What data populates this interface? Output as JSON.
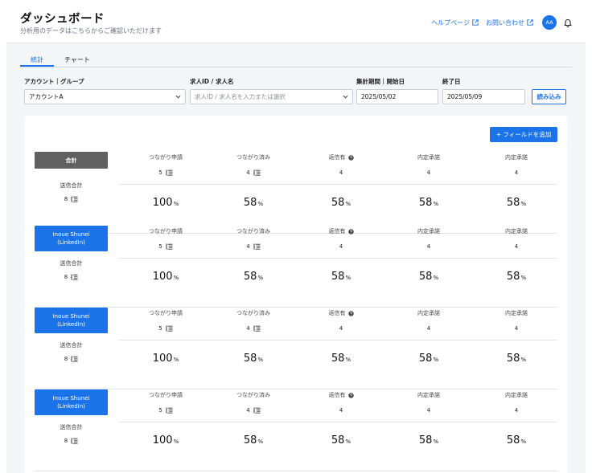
{
  "header": {
    "title": "ダッシュボード",
    "subtitle": "分析用のデータはこちらからご確認いただけます",
    "help_link": "ヘルプページ",
    "contact_link": "お問い合わせ",
    "avatar_initials": "AA"
  },
  "tabs": [
    {
      "label": "統計",
      "active": true
    },
    {
      "label": "チャート",
      "active": false
    }
  ],
  "filters": {
    "account_label": "アカウント｜グループ",
    "account_value": "アカウントA",
    "job_label": "求人ID / 求人名",
    "job_placeholder": "求人ID / 求人名を入力または選択",
    "period_label": "集計期間｜開始日",
    "start_date": "2025/05/02",
    "end_label": "終了日",
    "end_date": "2025/05/09",
    "load_button": "読み込み"
  },
  "add_field_button": "+ フィールドを追加",
  "send_total_label": "送信合計",
  "metric_labels": [
    "つながり申請",
    "つながり済み",
    "返信有",
    "内定承諾",
    "内定承諾"
  ],
  "groups": [
    {
      "name": "合計",
      "kind": "total",
      "send_total": "8",
      "counts": [
        "5",
        "4",
        "4",
        "4",
        "4"
      ],
      "percents": [
        "100",
        "58",
        "58",
        "58",
        "58"
      ]
    },
    {
      "name": "Inoue Shunei\n(LinkedIn)",
      "kind": "user",
      "send_total": "8",
      "counts": [
        "5",
        "4",
        "4",
        "4",
        "4"
      ],
      "percents": [
        "100",
        "58",
        "58",
        "58",
        "58"
      ]
    },
    {
      "name": "Inoue Shunei\n(LinkedIn)",
      "kind": "user",
      "send_total": "8",
      "counts": [
        "5",
        "4",
        "4",
        "4",
        "4"
      ],
      "percents": [
        "100",
        "58",
        "58",
        "58",
        "58"
      ]
    },
    {
      "name": "Inoue Shunei\n(LinkedIn)",
      "kind": "user",
      "send_total": "8",
      "counts": [
        "5",
        "4",
        "4",
        "4",
        "4"
      ],
      "percents": [
        "100",
        "58",
        "58",
        "58",
        "58"
      ]
    }
  ],
  "percent_unit": "%",
  "colors": {
    "accent": "#1a73e8",
    "total_badge": "#606060"
  }
}
